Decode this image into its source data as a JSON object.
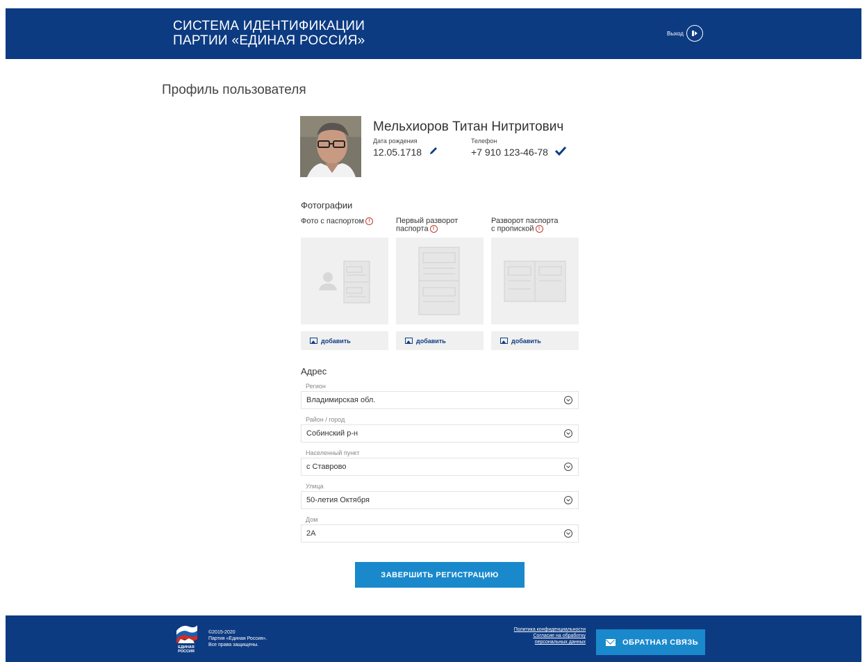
{
  "header": {
    "title_line1": "СИСТЕМА ИДЕНТИФИКАЦИИ",
    "title_line2": "ПАРТИИ «ЕДИНАЯ РОССИЯ»",
    "logout_label": "Выход"
  },
  "page": {
    "title": "Профиль пользователя"
  },
  "user": {
    "name": "Мельхиоров Титан Нитритович",
    "birth_label": "Дата рождения",
    "birth_value": "12.05.1718",
    "phone_label": "Телефон",
    "phone_value": "+7 910 123-46-78"
  },
  "photos": {
    "title": "Фотографии",
    "items": [
      {
        "label_line1": "Фото с паспортом",
        "label_line2": "",
        "add_label": "добавить"
      },
      {
        "label_line1": "Первый разворот",
        "label_line2": "паспорта",
        "add_label": "добавить"
      },
      {
        "label_line1": "Разворот паспорта",
        "label_line2": "с пропиской",
        "add_label": "добавить"
      }
    ]
  },
  "address": {
    "title": "Адрес",
    "fields": [
      {
        "label": "Регион",
        "value": "Владимирская обл."
      },
      {
        "label": "Район / город",
        "value": "Собинский р-н"
      },
      {
        "label": "Населенный пункт",
        "value": "с Ставрово"
      },
      {
        "label": "Улица",
        "value": "50-летия Октября"
      },
      {
        "label": "Дом",
        "value": "2А"
      }
    ]
  },
  "submit_label": "ЗАВЕРШИТЬ РЕГИСТРАЦИЮ",
  "footer": {
    "logo_text_line1": "ЕДИНАЯ",
    "logo_text_line2": "РОССИЯ",
    "copy_line1": "©2015-2020",
    "copy_line2": "Партия «Единая Россия».",
    "copy_line3": "Все права защищены.",
    "link_privacy": "Политика конфиденциальности",
    "link_consent_line1": "Согласие на обработку",
    "link_consent_line2": "персональных данных",
    "feedback_label": "ОБРАТНАЯ СВЯЗЬ"
  },
  "colors": {
    "brand_blue": "#0d3b82",
    "accent_blue": "#1a89cc",
    "warning_red": "#c0392b"
  }
}
